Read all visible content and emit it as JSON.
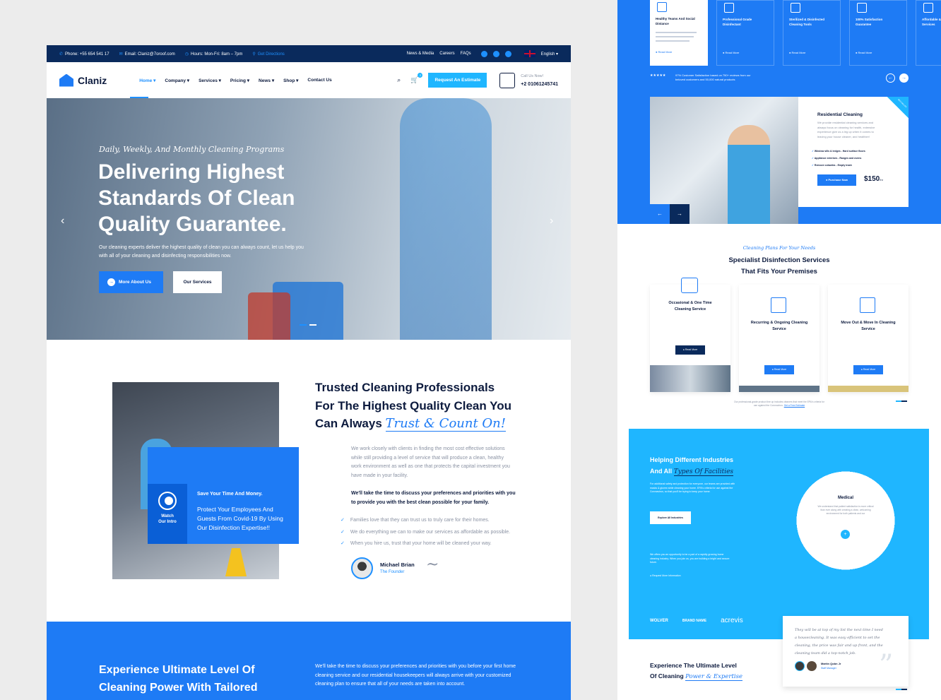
{
  "topbar": {
    "phone": "Phone: +55 654 541 17",
    "email": "Email: Claniz@7oroof.com",
    "hours": "Hours: Mon-Fri: 8am – 7pm",
    "directions": "Get Directions",
    "links": [
      "News & Media",
      "Careers",
      "FAQs"
    ],
    "language": "English"
  },
  "nav": {
    "logo": "Claniz",
    "menu": [
      "Home",
      "Company",
      "Services",
      "Pricing",
      "News",
      "Shop",
      "Contact Us"
    ],
    "cta": "Request An Estimate",
    "call_label": "Call Us Now!",
    "call_number": "+2 01061245741",
    "cart_count": "2"
  },
  "hero": {
    "subtitle": "Daily, Weekly, And Monthly Cleaning Programs",
    "title": "Delivering Highest Standards Of Clean Quality Guarantee.",
    "description": "Our cleaning experts deliver the highest quality of clean you can always count, let us help you with all of your cleaning and disinfecting responsibilities now.",
    "btn_primary": "More About Us",
    "btn_secondary": "Our Services"
  },
  "about": {
    "card_heading": "Save Your Time And Money.",
    "card_text": "Protect Your Employees And Guests From Covid-19 By Using Our Disinfection Expertise!!",
    "watch": "Watch Our Intro",
    "title_line1": "Trusted Cleaning Professionals",
    "title_line2": "For The Highest Quality Clean You",
    "title_line3": "Can Always",
    "title_script": "Trust & Count On!",
    "paragraph": "We work closely with clients in finding the most cost effective solutions while still providing a level of service that will produce a clean, healthy work environment as well as one that protects the capital investment you have made in your facility.",
    "bold": "We'll take the time to discuss your preferences and priorities with you to provide you with the best clean possible for your family.",
    "checks": [
      "Families love that they can trust us to truly care for their homes.",
      "We do everything we can to make our services as affordable as possible.",
      "When you hire us, trust that your home will be cleaned your way."
    ],
    "founder_name": "Michael Brian",
    "founder_role": "The Founder"
  },
  "band": {
    "title_line1": "Experience Ultimate Level Of",
    "title_line2": "Cleaning Power With Tailored",
    "text": "We'll take the time to discuss your preferences and priorities with you before your first home cleaning service and our residential housekeepers will always arrive with your customized cleaning plan to ensure that all of your needs are taken into account."
  },
  "right": {
    "features": [
      {
        "title": "Healthy Teams And Social Distance"
      },
      {
        "title": "Professional Grade Disinfectant"
      },
      {
        "title": "Sterilized & Disinfected Cleaning Tools"
      },
      {
        "title": "100% Satisfaction Guarantee"
      },
      {
        "title": "Affordable & Free Services"
      }
    ],
    "read_more": "Read More",
    "rating": "97% Customer Satisfaction based on 750+ reviews from our beloved customers and 50,000 natural products",
    "residential": {
      "title": "Residential Cleaning",
      "text": "We provide residential cleaning services and always focus on cleaning for health, extensive experience give us a leg up when it comes to leaving your house cleaner, and healthier!",
      "items": [
        "Window sills & ledges - Hard surface floors",
        "Appliance exteriors - Ranges and ovens",
        "Remove cobwebs - Empty trash"
      ],
      "btn": "Purchase Now",
      "price": "$150",
      "price_unit": "/hr",
      "tag": "BESTSELLER"
    },
    "services_sub": "Cleaning Plans For Your Needs",
    "services_title": "Specialist Disinfection Services That Fits Your Premises",
    "services": [
      {
        "title": "Occasional & One Time Cleaning Service"
      },
      {
        "title": "Recurring & Ongoing Cleaning Service"
      },
      {
        "title": "Move Out & Move In Cleaning Service"
      }
    ],
    "services_note": "Our professional-grade product line up includes cleaners that meet the EPA's criteria for use against the Coronavirus.",
    "services_link": "Get a Free Estimate",
    "industry_title": "Helping Different Industries",
    "industry_title2": "And All",
    "industry_script": "Types Of Facilities",
    "industry_text": "For additional safety and protection for everyone, our teams are provided with masks & gloves while cleaning your home. EPA's criteria for use against the Coronavirus, so that you'll be trying to keep your home.",
    "industry_btn": "Explore All Industries",
    "industry_text2": "We offers you an opportunity to be a part of a rapidly growing home cleaning industry. When you join us, you are building a bright and secure future.",
    "industry_link": "Request More Information",
    "medical": "Medical",
    "medical_text": "We understand that patient satisfaction is more critical than ever along with creating a clean, welcoming environment for both patients and our",
    "brands": [
      "WOLVER",
      "BRAND NAME",
      "acrevis"
    ],
    "quote": "They will be at top of my list the next time I need a housecleaning. It was easy efficient to set the cleaning, the price was fair and up front, and the cleaning team did a top-notch job.",
    "quote_author": "Martin Qobn Jr",
    "quote_role": "Staff Manager",
    "bottom_title": "Experience The Ultimate Level",
    "bottom_title2": "Of Cleaning",
    "bottom_script": "Power & Expertise"
  }
}
